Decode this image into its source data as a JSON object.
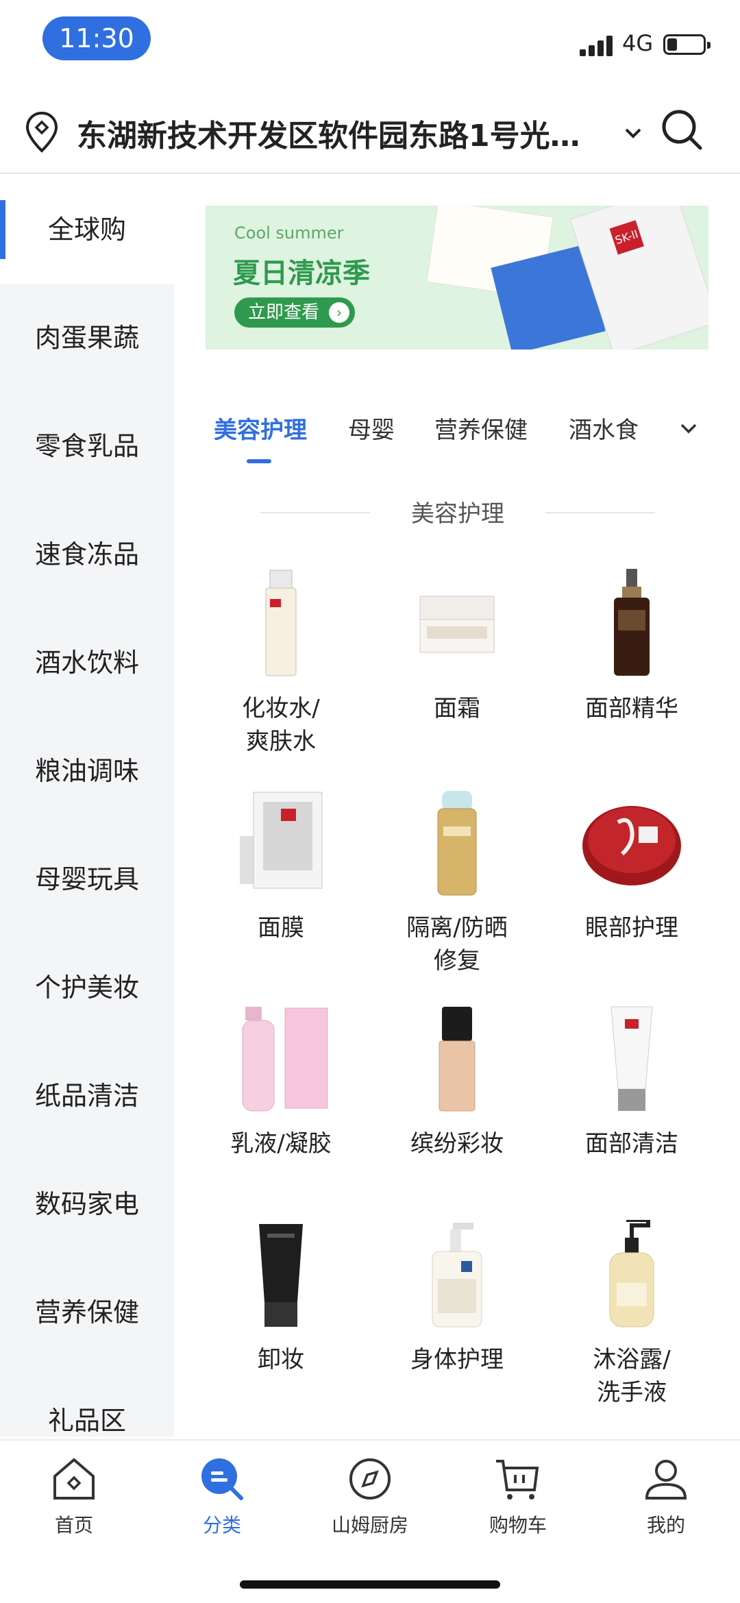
{
  "status_bar": {
    "time": "11:30",
    "network": "4G"
  },
  "address": {
    "text": "东湖新技术开发区软件园东路1号光…"
  },
  "sidebar": {
    "items": [
      {
        "label": "全球购",
        "active": true
      },
      {
        "label": "肉蛋果蔬"
      },
      {
        "label": "零食乳品"
      },
      {
        "label": "速食冻品"
      },
      {
        "label": "酒水饮料"
      },
      {
        "label": "粮油调味"
      },
      {
        "label": "母婴玩具"
      },
      {
        "label": "个护美妆"
      },
      {
        "label": "纸品清洁"
      },
      {
        "label": "数码家电"
      },
      {
        "label": "营养保健"
      },
      {
        "label": "礼品区"
      }
    ]
  },
  "banner": {
    "subtitle_en": "Cool summer",
    "title": "夏日清凉季",
    "button": "立即查看",
    "brand_mark": "SK-II"
  },
  "tabs": {
    "items": [
      "美容护理",
      "母婴",
      "营养保健",
      "酒水食"
    ],
    "active_index": 0
  },
  "section": {
    "title": "美容护理"
  },
  "products": [
    {
      "label": "化妆水/\n爽肤水"
    },
    {
      "label": "面霜"
    },
    {
      "label": "面部精华"
    },
    {
      "label": "面膜"
    },
    {
      "label": "隔离/防晒\n修复"
    },
    {
      "label": "眼部护理"
    },
    {
      "label": "乳液/凝胶"
    },
    {
      "label": "缤纷彩妆"
    },
    {
      "label": "面部清洁"
    },
    {
      "label": "卸妆"
    },
    {
      "label": "身体护理"
    },
    {
      "label": "沐浴露/\n洗手液"
    }
  ],
  "bottom_nav": {
    "items": [
      {
        "label": "首页",
        "icon": "home-icon"
      },
      {
        "label": "分类",
        "icon": "category-icon",
        "active": true
      },
      {
        "label": "山姆厨房",
        "icon": "compass-icon"
      },
      {
        "label": "购物车",
        "icon": "cart-icon"
      },
      {
        "label": "我的",
        "icon": "profile-icon"
      }
    ]
  },
  "colors": {
    "accent": "#2f6fe0",
    "banner_green": "#2f9a4e",
    "sidebar_bg": "#f4f5f7"
  }
}
